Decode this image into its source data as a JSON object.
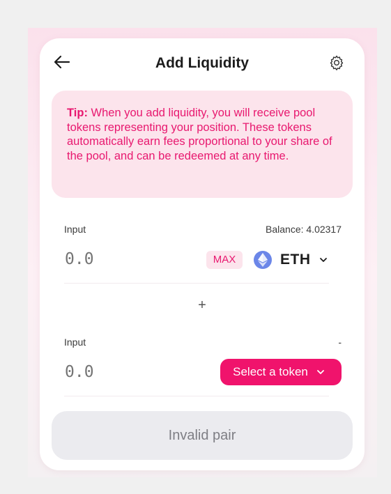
{
  "header": {
    "title": "Add Liquidity",
    "back_icon": "arrow-left-icon",
    "settings_icon": "gear-icon"
  },
  "tip": {
    "label": "Tip:",
    "text": " When you add liquidity, you will receive pool tokens representing your position. These tokens automatically earn fees proportional to your share of the pool, and can be redeemed at any time."
  },
  "input_a": {
    "label": "Input",
    "balance": "Balance: 4.02317",
    "placeholder": "0.0",
    "max_label": "MAX",
    "token": "ETH",
    "token_icon": "ethereum-icon"
  },
  "plus_sign": "+",
  "input_b": {
    "label": "Input",
    "balance": "-",
    "placeholder": "0.0",
    "select_label": "Select a token"
  },
  "submit": {
    "label": "Invalid pair"
  },
  "colors": {
    "accent": "#f0136c",
    "tip_background": "#fce4ec",
    "tip_text": "#e8186f",
    "eth_logo": "#6b86e8",
    "disabled_button": "#ebebef"
  }
}
